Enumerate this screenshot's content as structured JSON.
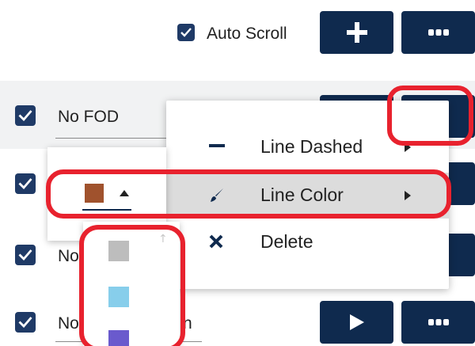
{
  "toolbar": {
    "auto_scroll_label": "Auto Scroll",
    "auto_scroll_checked": true
  },
  "rows": [
    {
      "checked": true,
      "name": "No FOD"
    },
    {
      "checked": true,
      "name": ""
    },
    {
      "checked": true,
      "name": "No"
    },
    {
      "checked": true,
      "name": "No",
      "trailing_fragment": "n"
    }
  ],
  "context_menu": {
    "items": [
      {
        "label": "Line Dashed",
        "icon": "dash-icon",
        "has_submenu": true
      },
      {
        "label": "Line Color",
        "icon": "brush-icon",
        "has_submenu": true,
        "highlighted": true
      },
      {
        "label": "Delete",
        "icon": "close-icon",
        "has_submenu": false
      }
    ]
  },
  "color_picker": {
    "selected_color": "#a0522d",
    "swatches": [
      "#bdbdbd",
      "#87ceeb",
      "#6a5acd"
    ]
  },
  "colors": {
    "navy": "#0f2a4e",
    "checkbox": "#1f3a66",
    "highlight_red": "#e8222e",
    "menu_highlight": "#dcdcdc"
  }
}
